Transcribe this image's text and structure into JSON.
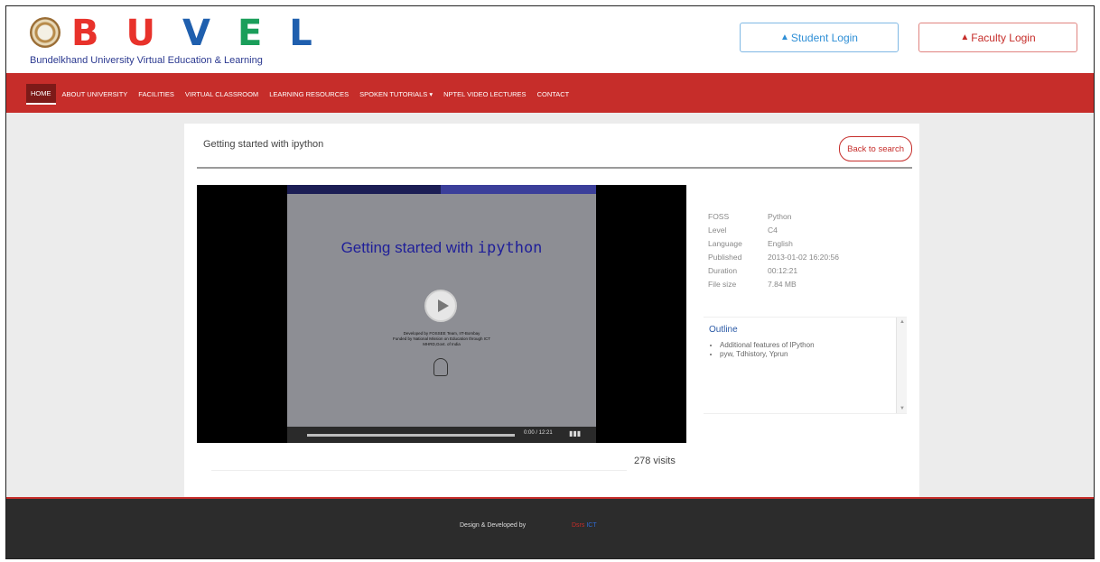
{
  "header": {
    "logo_letters": [
      "B",
      "U",
      "V",
      "E",
      "L"
    ],
    "logo_letter_colors": [
      "#e8322b",
      "#e8322b",
      "#1f5fae",
      "#1a9e5a",
      "#1f5fae"
    ],
    "tagline": "Bundelkhand University Virtual Education & Learning",
    "student_login": "Student Login",
    "faculty_login": "Faculty Login",
    "student_color": "#2f8fd6",
    "faculty_color": "#c62d2a"
  },
  "nav": {
    "items": [
      "HOME",
      "ABOUT UNIVERSITY",
      "FACILITIES",
      "VIRTUAL CLASSROOM",
      "LEARNING RESOURCES",
      "SPOKEN TUTORIALS ▾",
      "NPTEL VIDEO LECTURES",
      "CONTACT"
    ],
    "active": "HOME",
    "bg": "#c62d2a"
  },
  "main": {
    "title": "Getting started with ipython",
    "back_label": "Back to search",
    "video": {
      "slide_title_prefix": "Getting started with ",
      "slide_title_mono": "ipython",
      "credits": "Developed by FOSSEE Team, IIT-Bombay\nFunded by National Mission on Education through ICT\nMHRD,Govt. of India",
      "time": "0:00 / 12:21"
    },
    "visits": "278 visits",
    "meta": [
      {
        "key": "FOSS",
        "value": "Python"
      },
      {
        "key": "Level",
        "value": "C4"
      },
      {
        "key": "Language",
        "value": "English"
      },
      {
        "key": "Published",
        "value": "2013-01-02 16:20:56"
      },
      {
        "key": "Duration",
        "value": "00:12:21"
      },
      {
        "key": "File size",
        "value": "7.84 MB"
      }
    ],
    "outline_heading": "Outline",
    "outline_items": [
      "Additional features of IPython",
      "pyw, Tdhistory, Yprun"
    ]
  },
  "footer": {
    "text": "Design & Developed by",
    "brand_a": "Dsrs",
    "brand_b": "ICT"
  }
}
